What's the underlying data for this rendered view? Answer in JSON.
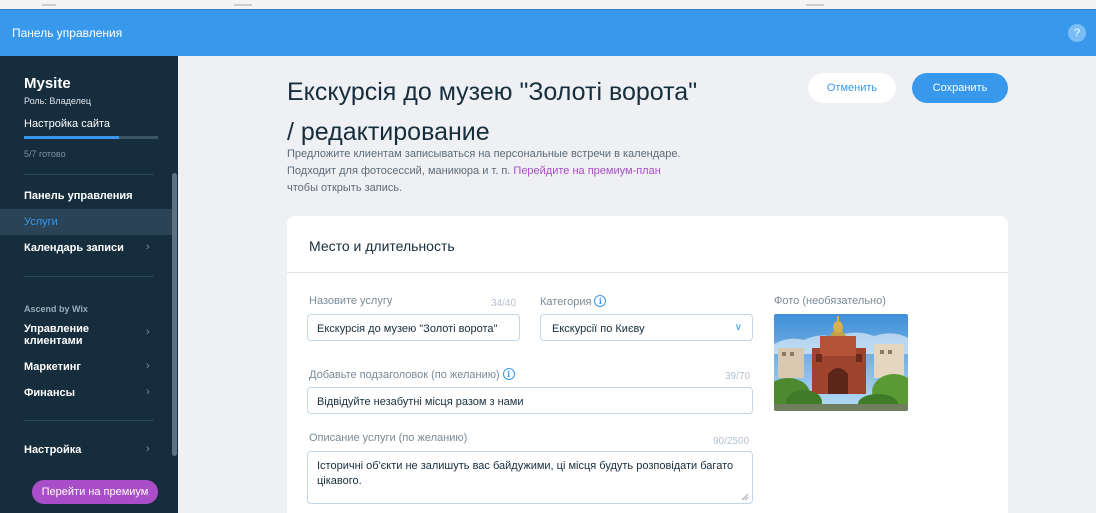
{
  "header": {
    "title": "Панель управления",
    "help_label": "?"
  },
  "sidebar": {
    "site_name": "Mysite",
    "role": "Роль: Владелец",
    "setup_label": "Настройка сайта",
    "setup_progress": 0.71,
    "setup_status": "5/7 готово",
    "items": [
      {
        "label": "Панель управления",
        "has_arrow": false,
        "active": false
      },
      {
        "label": "Услуги",
        "has_arrow": false,
        "active": true
      },
      {
        "label": "Календарь записи",
        "has_arrow": true,
        "active": false
      }
    ],
    "section_title": "Ascend by Wix",
    "section_items": [
      {
        "label": "Управление клиентами",
        "has_arrow": true
      },
      {
        "label": "Маркетинг",
        "has_arrow": true
      },
      {
        "label": "Финансы",
        "has_arrow": true
      }
    ],
    "settings_label": "Настройка",
    "premium_button": "Перейти на премиум"
  },
  "page": {
    "title": "Екскурсія до музею \"Золоті ворота\" / редактирование",
    "description": "Предложите клиентам записываться на персональные встречи в календаре. Подходит для фотосессий, маникюра и т. п.",
    "premium_link": "Перейдите на премиум-план",
    "description_tail": "чтобы открыть запись.",
    "cancel_button": "Отменить",
    "save_button": "Сохранить"
  },
  "card": {
    "title": "Место и длительность",
    "service_name": {
      "label": "Назовите услугу",
      "counter": "34/40",
      "value": "Екскурсія до музею \"Золоті ворота\""
    },
    "category": {
      "label": "Категория",
      "value": "Екскурсії по Києву"
    },
    "photo_label": "Фото (необязательно)",
    "subtitle": {
      "label": "Добавьте подзаголовок (по желанию)",
      "counter": "39/70",
      "value": "Відвідуйте незабутні місця разом з нами"
    },
    "description": {
      "label": "Описание услуги (по желанию)",
      "counter": "90/2500",
      "value": "Історичні об'єкти не залишуть вас байдужими, ці місця будуть розповідати багато цікавого."
    }
  },
  "colors": {
    "brand": "#3899ec",
    "sidebar": "#162d3d",
    "premium": "#aa4dc8"
  },
  "icons": {
    "info": "info-circle-icon",
    "dropdown": "chevron-down-icon",
    "nav_arrow": "chevron-right-icon"
  }
}
